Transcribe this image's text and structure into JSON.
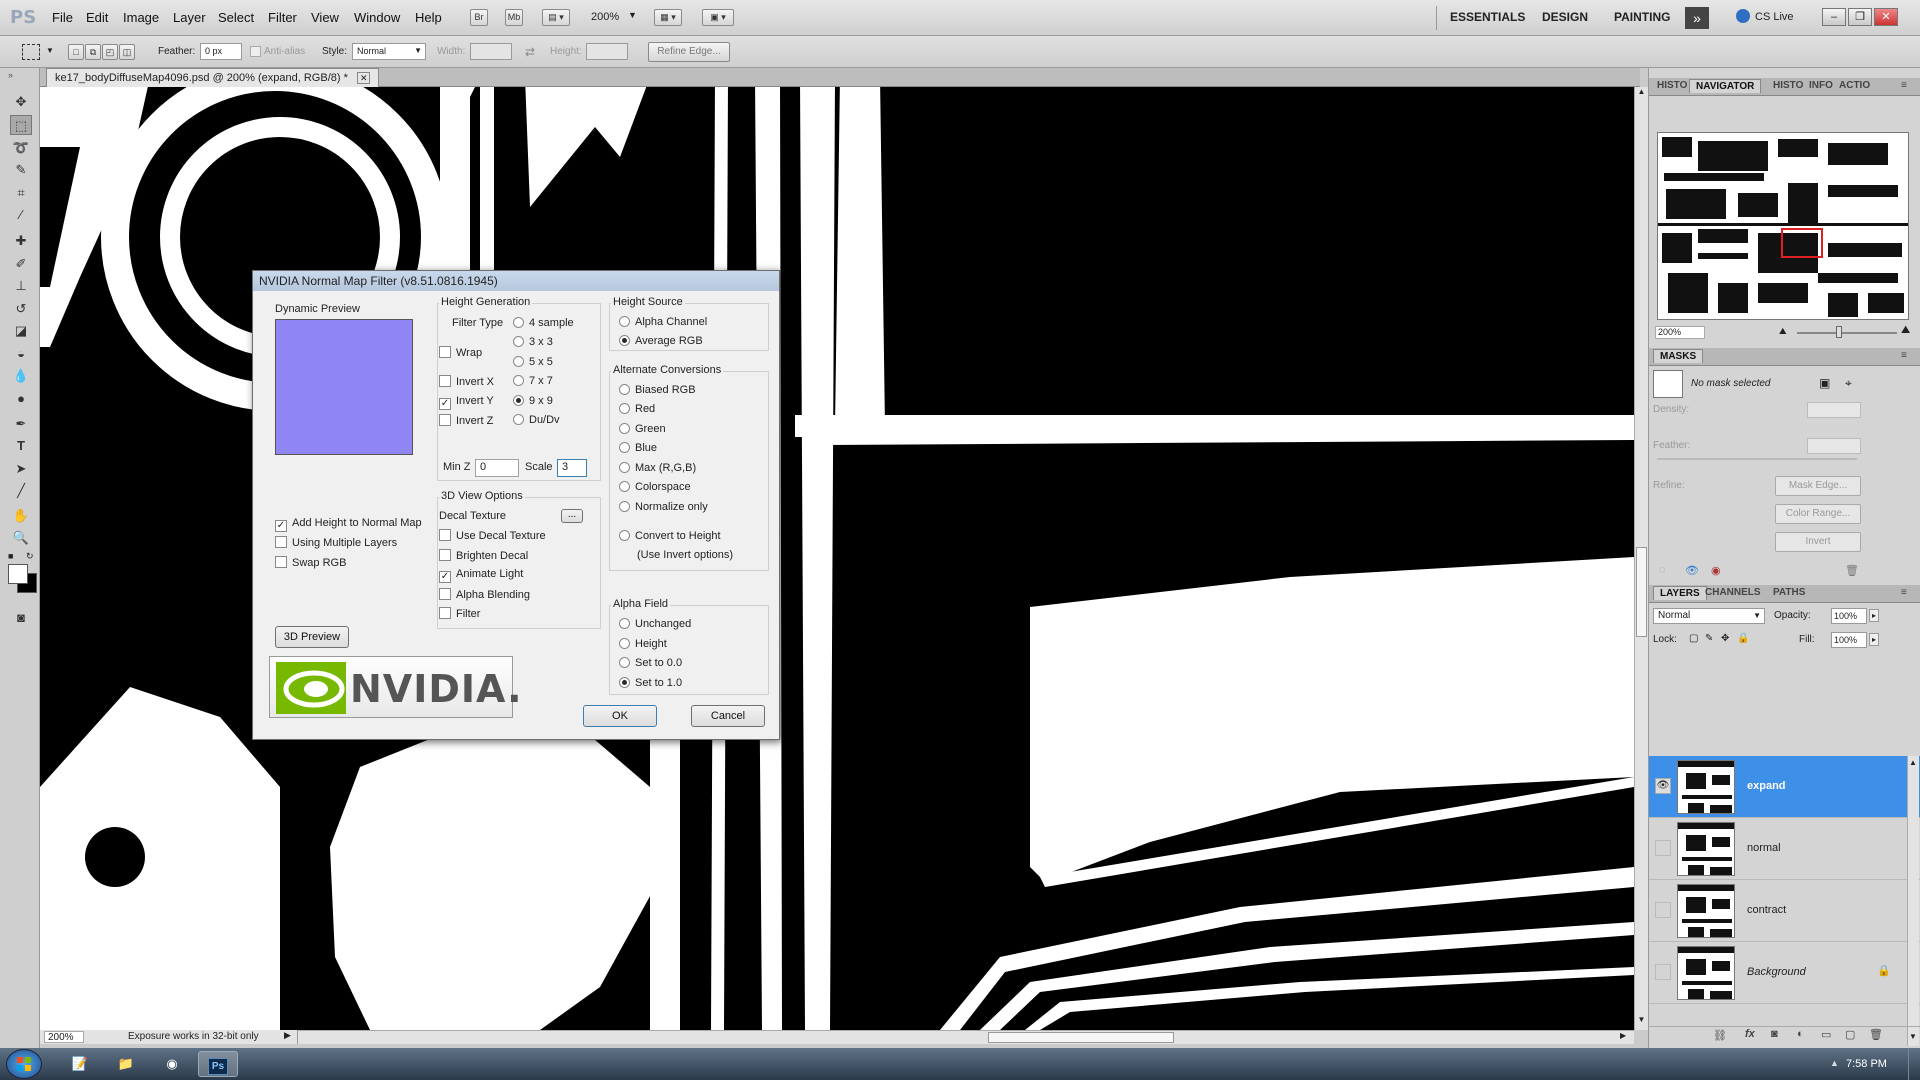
{
  "app": {
    "logo": "PS",
    "menu": [
      "File",
      "Edit",
      "Image",
      "Layer",
      "Select",
      "Filter",
      "View",
      "Window",
      "Help"
    ],
    "toolbar_buttons": [
      "Br",
      "Mb"
    ],
    "zoom": "200%",
    "workspaces": [
      "ESSENTIALS",
      "DESIGN",
      "PAINTING"
    ],
    "cs_live": "CS Live"
  },
  "options": {
    "feather_label": "Feather:",
    "feather_value": "0 px",
    "antialias_label": "Anti-alias",
    "style_label": "Style:",
    "style_value": "Normal",
    "width_label": "Width:",
    "height_label": "Height:",
    "refine_edge": "Refine Edge..."
  },
  "document": {
    "tab_title": "ke17_bodyDiffuseMap4096.psd @ 200% (expand, RGB/8) *",
    "zoom_readout": "200%",
    "status_text": "Exposure works in 32-bit only"
  },
  "dialog": {
    "title": "NVIDIA Normal Map Filter (v8.51.0816.1945)",
    "dynamic_preview": "Dynamic Preview",
    "height_generation": "Height Generation",
    "filter_type": "Filter Type",
    "filter_options": [
      "4 sample",
      "3 x 3",
      "5 x 5",
      "7 x 7",
      "9 x 9",
      "Du/Dv"
    ],
    "filter_selected": "9 x 9",
    "wrap": "Wrap",
    "invert_x": "Invert X",
    "invert_y": "Invert Y",
    "invert_z": "Invert Z",
    "minz_label": "Min Z",
    "minz_value": "0",
    "scale_label": "Scale",
    "scale_value": "3",
    "height_source": "Height Source",
    "alpha_channel": "Alpha Channel",
    "average_rgb": "Average RGB",
    "alternate_conversions": "Alternate Conversions",
    "alt_options": [
      "Biased RGB",
      "Red",
      "Green",
      "Blue",
      "Max (R,G,B)",
      "Colorspace",
      "Normalize only"
    ],
    "convert_to_height": "Convert to Height",
    "use_invert": "(Use Invert options)",
    "add_height": "Add Height to Normal Map",
    "using_multiple_layers": "Using Multiple Layers",
    "swap_rgb": "Swap RGB",
    "view_options_3d": "3D View Options",
    "decal_texture": "Decal Texture",
    "decal_btn": "...",
    "use_decal_texture": "Use Decal Texture",
    "brighten_decal": "Brighten Decal",
    "animate_light": "Animate Light",
    "alpha_blending": "Alpha Blending",
    "filter": "Filter",
    "preview_3d_btn": "3D Preview",
    "alpha_field": "Alpha Field",
    "alpha_options": [
      "Unchanged",
      "Height",
      "Set to 0.0",
      "Set to 1.0"
    ],
    "alpha_selected": "Set to 1.0",
    "nvidia_logo": "NVIDIA.",
    "ok": "OK",
    "cancel": "Cancel",
    "preview_color": "#8f85f5"
  },
  "panels": {
    "top_tabs": [
      "HISTO",
      "NAVIGATOR",
      "HISTO",
      "INFO",
      "ACTIO"
    ],
    "nav_zoom": "200%",
    "masks_tab": "MASKS",
    "no_mask": "No mask selected",
    "density": "Density:",
    "feather": "Feather:",
    "refine": "Refine:",
    "mask_edge": "Mask Edge...",
    "color_range": "Color Range...",
    "invert": "Invert",
    "layer_tabs": [
      "LAYERS",
      "CHANNELS",
      "PATHS"
    ],
    "blend_mode": "Normal",
    "opacity_label": "Opacity:",
    "opacity_value": "100%",
    "lock_label": "Lock:",
    "fill_label": "Fill:",
    "fill_value": "100%",
    "layers": [
      {
        "name": "expand",
        "selected": true,
        "visible": true
      },
      {
        "name": "normal",
        "selected": false,
        "visible": false
      },
      {
        "name": "contract",
        "selected": false,
        "visible": false
      },
      {
        "name": "Background",
        "selected": false,
        "visible": false,
        "locked": true
      }
    ]
  },
  "taskbar": {
    "time": "7:58 PM",
    "ps_label": "Ps"
  }
}
